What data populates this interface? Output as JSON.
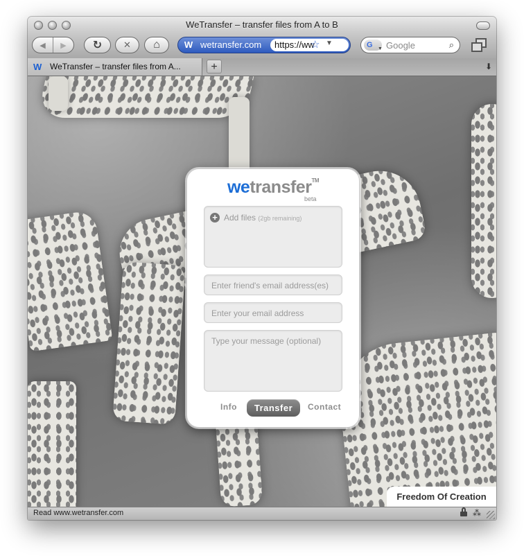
{
  "window": {
    "title": "WeTransfer – transfer files from A to B"
  },
  "toolbar": {
    "back_icon": "◀",
    "forward_icon": "▶",
    "reload_icon": "↻",
    "stop_icon": "✕",
    "home_icon": "⌂",
    "url_badge": "W",
    "url_domain": "wetransfer.com",
    "url_value": "https://ww",
    "bookmark_icon": "☆",
    "url_dropdown_icon": "▼",
    "search_placeholder": "Google",
    "search_engine_g": "G",
    "search_icon": "⌕"
  },
  "tabs": [
    {
      "label": "WeTransfer – transfer files from A..."
    }
  ],
  "tabbar": {
    "add_tab": "+",
    "menu_icon": "⬇"
  },
  "panel": {
    "logo_we": "we",
    "logo_rest": "transfer",
    "logo_tm": "TM",
    "beta": "beta",
    "add_files_icon": "+",
    "add_files_label": "Add files",
    "remaining": "(2gb remaining)",
    "friend_placeholder": "Enter friend's email address(es)",
    "your_email_placeholder": "Enter your email address",
    "message_placeholder": "Type your message (optional)",
    "info_link": "Info",
    "transfer_button": "Transfer",
    "contact_link": "Contact"
  },
  "background_credit": "Freedom Of Creation",
  "statusbar": {
    "text": "Read www.wetransfer.com",
    "bug_icon": "⁂"
  },
  "colors": {
    "brand_blue": "#1d6ed6",
    "url_bar_blue": "#2e5bbf",
    "button_gray": "#5d5d5d"
  }
}
